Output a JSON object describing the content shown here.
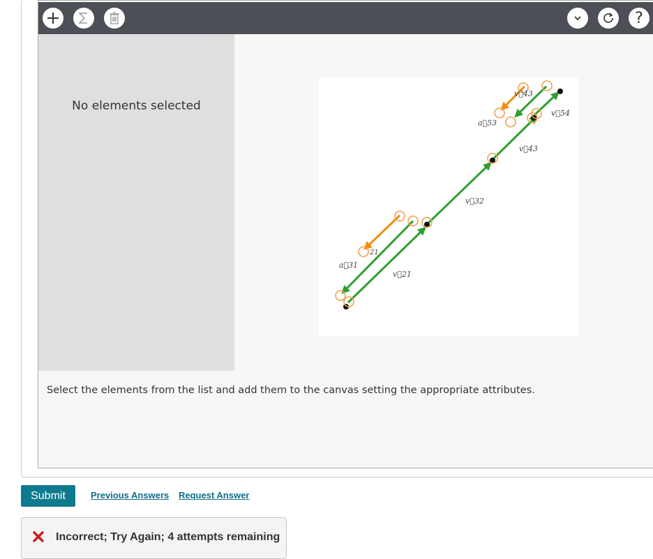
{
  "toolbar": {
    "left_buttons": [
      "add-icon",
      "sum-icon",
      "trash-icon"
    ],
    "right_buttons": [
      "chevron-down-icon",
      "reset-icon",
      "help-icon"
    ],
    "help_glyph": "?"
  },
  "sidebar": {
    "empty_text": "No elements selected"
  },
  "canvas": {
    "vector_labels": {
      "v43_top": "v⃗43",
      "a53": "a⃗53",
      "v54": "v⃗54",
      "v43": "v⃗43",
      "v32": "v⃗32",
      "v21_partial": "21",
      "a31": "a⃗31",
      "v21": "v⃗21"
    },
    "colors": {
      "velocity": "#2e9e2e",
      "acceleration": "#f28c0f",
      "handle": "#f0a050"
    }
  },
  "instructions": "Select the elements from the list and add them to the canvas setting the appropriate attributes.",
  "actions": {
    "submit_label": "Submit",
    "previous_answers_label": "Previous Answers",
    "request_answer_label": "Request Answer"
  },
  "feedback": {
    "message": "Incorrect; Try Again; 4 attempts remaining",
    "status_color": "#cc1f1f"
  }
}
